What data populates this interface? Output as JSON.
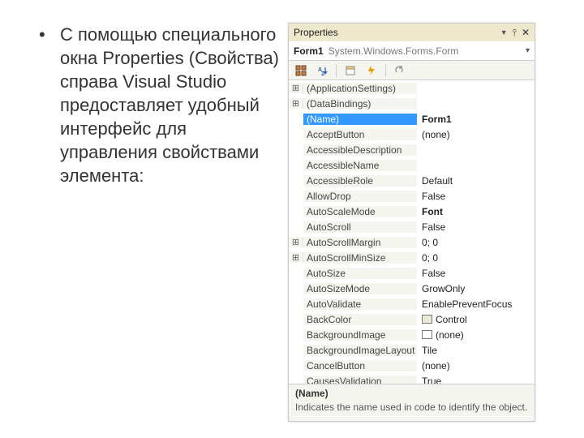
{
  "left_text": "С помощью специального окна Properties (Свойства) справа Visual Studio предоставляет удобный интерфейс для управления свойствами элемента:",
  "panel": {
    "title": "Properties",
    "selector_name": "Form1",
    "selector_type": "System.Windows.Forms.Form",
    "categories": [
      {
        "expander": "⊞",
        "name": "(ApplicationSettings)",
        "value": ""
      },
      {
        "expander": "⊞",
        "name": "(DataBindings)",
        "value": ""
      }
    ],
    "props": [
      {
        "name": "(Name)",
        "value": "Form1",
        "bold": true,
        "selected": true
      },
      {
        "name": "AcceptButton",
        "value": "(none)"
      },
      {
        "name": "AccessibleDescription",
        "value": ""
      },
      {
        "name": "AccessibleName",
        "value": ""
      },
      {
        "name": "AccessibleRole",
        "value": "Default"
      },
      {
        "name": "AllowDrop",
        "value": "False"
      },
      {
        "name": "AutoScaleMode",
        "value": "Font",
        "bold": true
      },
      {
        "name": "AutoScroll",
        "value": "False"
      },
      {
        "name": "AutoScrollMargin",
        "value": "0; 0",
        "expander": "⊞"
      },
      {
        "name": "AutoScrollMinSize",
        "value": "0; 0",
        "expander": "⊞"
      },
      {
        "name": "AutoSize",
        "value": "False"
      },
      {
        "name": "AutoSizeMode",
        "value": "GrowOnly"
      },
      {
        "name": "AutoValidate",
        "value": "EnablePreventFocus"
      },
      {
        "name": "BackColor",
        "value": "Control",
        "swatch": "control"
      },
      {
        "name": "BackgroundImage",
        "value": "(none)",
        "swatch": "none"
      },
      {
        "name": "BackgroundImageLayout",
        "value": "Tile"
      },
      {
        "name": "CancelButton",
        "value": "(none)"
      },
      {
        "name": "CausesValidation",
        "value": "True"
      }
    ],
    "desc_title": "(Name)",
    "desc_text": "Indicates the name used in code to identify the object."
  }
}
